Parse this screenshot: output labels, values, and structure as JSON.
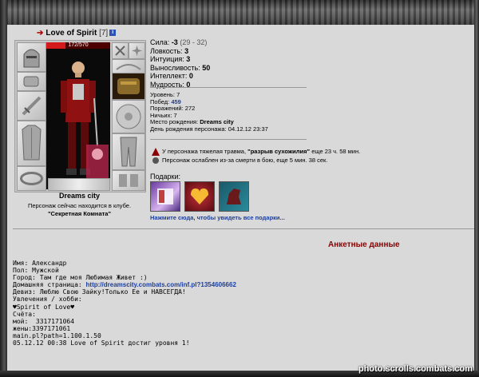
{
  "character": {
    "name": "Love of Spirit",
    "level": "[7]",
    "hp": "172/570",
    "hp_fraction": 0.3,
    "city": "Dreams city",
    "club_note": "Персонаж сейчас находится в клубе.",
    "club_room": "\"Секретная Комната\""
  },
  "stats": [
    {
      "label": "Сила:",
      "value": "-3",
      "extra": "(29 - 32)"
    },
    {
      "label": "Ловкость:",
      "value": "3",
      "extra": ""
    },
    {
      "label": "Интуиция:",
      "value": "3",
      "extra": ""
    },
    {
      "label": "Выносливость:",
      "value": "50",
      "extra": ""
    },
    {
      "label": "Интеллект:",
      "value": "0",
      "extra": ""
    },
    {
      "label": "Мудрость:",
      "value": "0",
      "extra": ""
    }
  ],
  "details": {
    "level": {
      "label": "Уровень:",
      "value": "7"
    },
    "wins": {
      "label": "Побед:",
      "value": "459"
    },
    "losses": {
      "label": "Поражений:",
      "value": "272"
    },
    "draws": {
      "label": "Ничьих:",
      "value": "7"
    },
    "birthplace": {
      "label": "Место рождения:",
      "value": "Dreams city"
    },
    "birthday": {
      "label": "День рождения персонажа:",
      "value": "04.12.12 23:37"
    }
  },
  "effects": {
    "trauma_prefix": "У персонажа тяжелая травма,",
    "trauma_name": "\"разрыв сухожилия\"",
    "trauma_suffix": "еще 23 ч. 58 мин.",
    "weak": "Персонаж ослаблен из-за смерти в бою, еще 5 мин. 38 сек."
  },
  "gifts": {
    "label": "Подарки:",
    "link": "Нажмите сюда, чтобы увидеть все подарки..."
  },
  "anketa": {
    "title": "Анкетные данные",
    "lines": [
      "Имя: Александр",
      "Пол: Мужской",
      "Город: Там где моя Любимая Живет :)"
    ],
    "homepage_label": "Домашняя страница:",
    "homepage_url": "http://dreamscity.combats.com/inf.pl?1354606662",
    "lines2": [
      "Девиз: Люблю Свою Зайку!Только Ее и НАВСЕГДА!",
      "Увлечения / хобби:",
      "♥Spirit of Love♥",
      "",
      "Счёта:",
      "мой:  3317171064",
      "жены:3397171061",
      "",
      "main.pl?path=1.100.1.50",
      "",
      "05.12.12 00:38 Love of Spirit достиг уровня 1!"
    ]
  },
  "watermark": "photo.scrolls.combats.com"
}
